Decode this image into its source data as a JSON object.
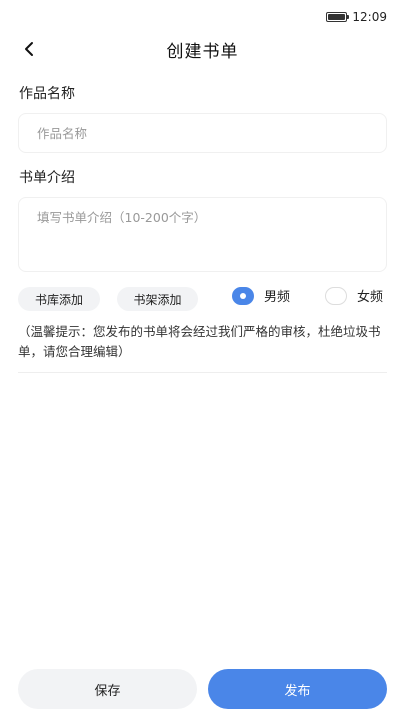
{
  "status_bar": {
    "time": "12:09"
  },
  "header": {
    "title": "创建书单"
  },
  "form": {
    "name_label": "作品名称",
    "name_value": "",
    "name_placeholder": "作品名称",
    "intro_label": "书单介绍",
    "intro_value": "",
    "intro_placeholder": "填写书单介绍（10-200个字）"
  },
  "actions": {
    "library_add": "书库添加",
    "shelf_add": "书架添加"
  },
  "channel": {
    "options": [
      "男频",
      "女频"
    ],
    "selected": "男频"
  },
  "tip": "（温馨提示：您发布的书单将会经过我们严格的审核，杜绝垃圾书单，请您合理编辑）",
  "footer": {
    "save_label": "保存",
    "publish_label": "发布"
  },
  "colors": {
    "accent": "#4a86e8",
    "pill_bg": "#f2f3f5"
  }
}
